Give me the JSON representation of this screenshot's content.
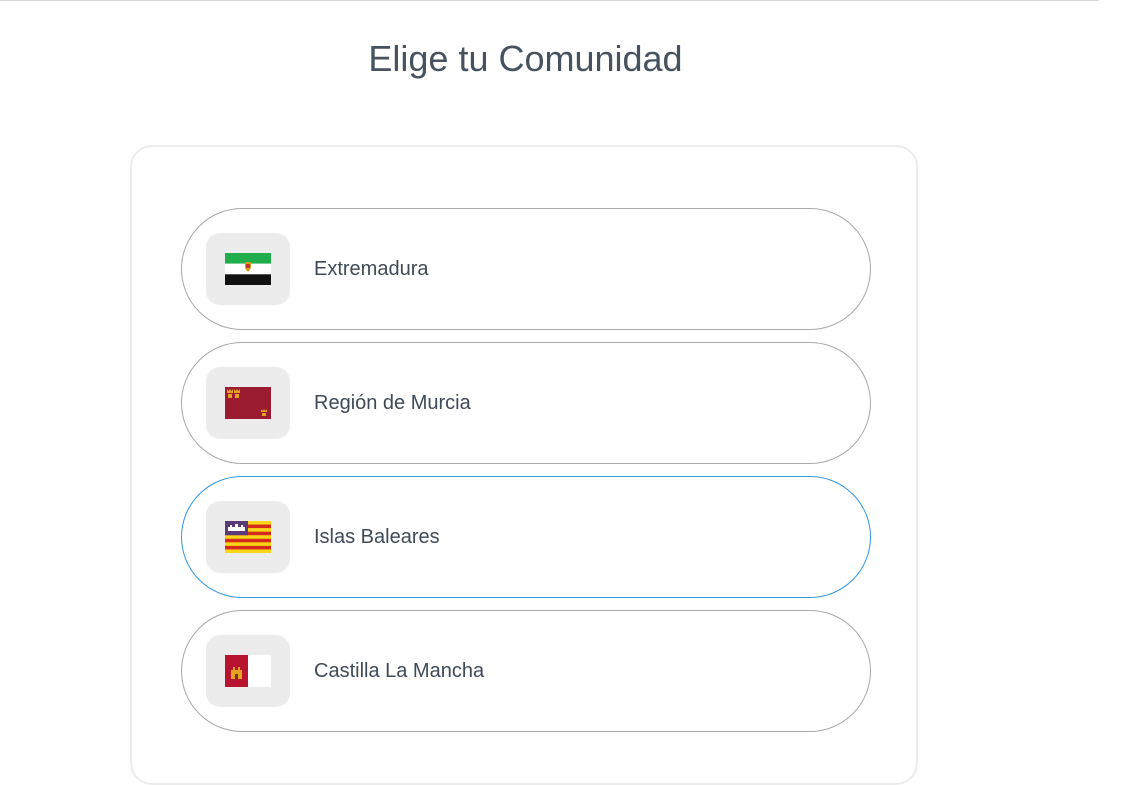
{
  "page": {
    "title": "Elige tu Comunidad"
  },
  "options": [
    {
      "label": "Extremadura",
      "flag_icon": "extremadura-flag-icon",
      "selected": false
    },
    {
      "label": "Región de Murcia",
      "flag_icon": "murcia-flag-icon",
      "selected": false
    },
    {
      "label": "Islas Baleares",
      "flag_icon": "baleares-flag-icon",
      "selected": true
    },
    {
      "label": "Castilla La Mancha",
      "flag_icon": "castilla-la-mancha-flag-icon",
      "selected": false
    }
  ],
  "colors": {
    "title_text": "#465260",
    "option_border": "#a8a8a8",
    "option_selected_border": "#3398e0",
    "flag_box_bg": "#ececec"
  }
}
